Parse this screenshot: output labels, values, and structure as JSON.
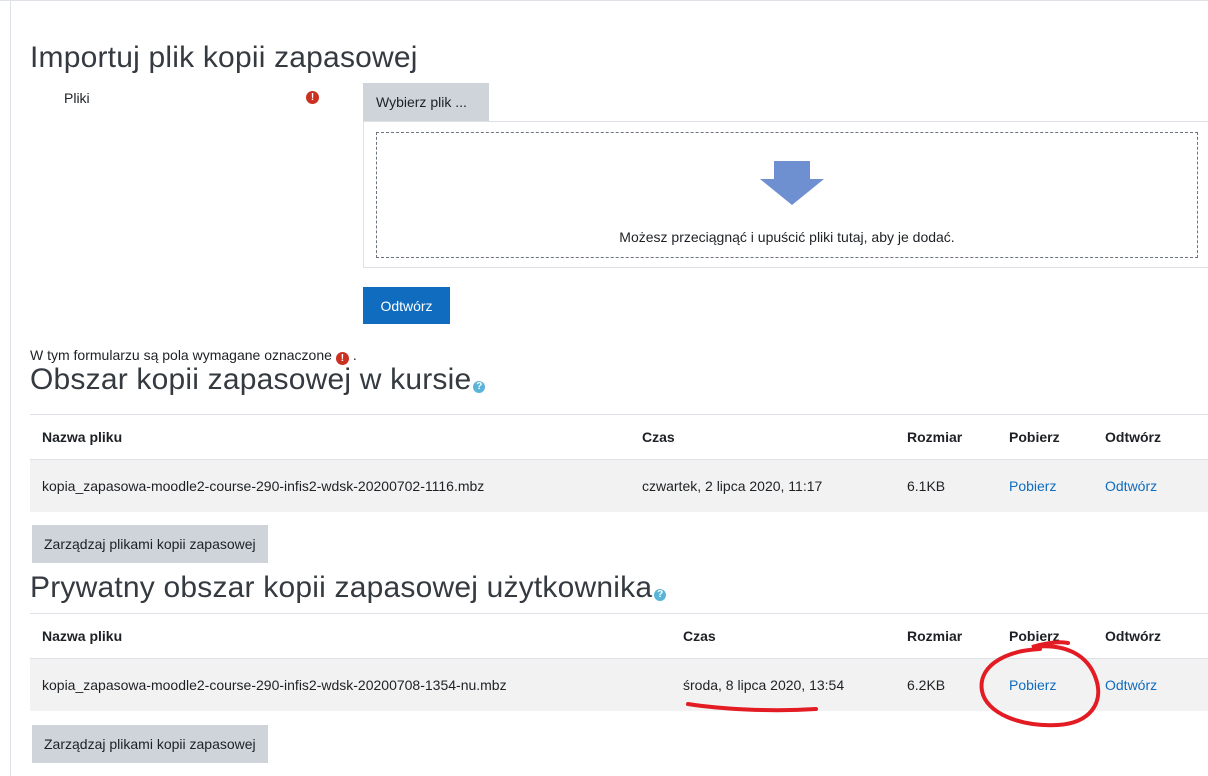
{
  "import": {
    "title": "Importuj plik kopii zapasowej",
    "files_label": "Pliki",
    "choose_file_label": "Wybierz plik ...",
    "drop_text": "Możesz przeciągnąć i upuścić pliki tutaj, aby je dodać.",
    "restore_button": "Odtwórz",
    "required_note_before": "W tym formularzu są pola wymagane oznaczone",
    "required_note_after": "."
  },
  "icons": {
    "required": "exclamation-circle-icon",
    "help": "question-circle-icon",
    "drop": "arrow-down-icon",
    "required_glyph": "!",
    "help_glyph": "?"
  },
  "course_area": {
    "title": "Obszar kopii zapasowej w kursie",
    "columns": [
      "Nazwa pliku",
      "Czas",
      "Rozmiar",
      "Pobierz",
      "Odtwórz"
    ],
    "rows": [
      {
        "filename": "kopia_zapasowa-moodle2-course-290-infis2-wdsk-20200702-1116.mbz",
        "time": "czwartek, 2 lipca 2020, 11:17",
        "size": "6.1KB",
        "download": "Pobierz",
        "restore": "Odtwórz"
      }
    ],
    "manage_button": "Zarządzaj plikami kopii zapasowej"
  },
  "user_area": {
    "title": "Prywatny obszar kopii zapasowej użytkownika",
    "columns": [
      "Nazwa pliku",
      "Czas",
      "Rozmiar",
      "Pobierz",
      "Odtwórz"
    ],
    "rows": [
      {
        "filename": "kopia_zapasowa-moodle2-course-290-infis2-wdsk-20200708-1354-nu.mbz",
        "time": "środa, 8 lipca 2020, 13:54",
        "size": "6.2KB",
        "download": "Pobierz",
        "restore": "Odtwórz"
      }
    ],
    "manage_button": "Zarządzaj plikami kopii zapasowej"
  },
  "colors": {
    "primary": "#0f6cbf",
    "required": "#ca3120",
    "help": "#5bb4d8",
    "annotation": "#e31b23"
  }
}
